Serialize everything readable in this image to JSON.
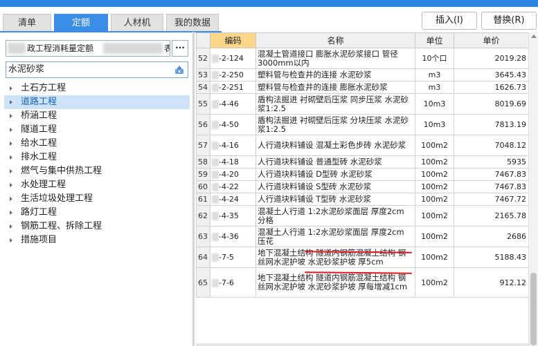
{
  "title": "",
  "tabs": [
    {
      "label": "清单",
      "active": false
    },
    {
      "label": "定额",
      "active": true
    },
    {
      "label": "人材机",
      "active": false
    },
    {
      "label": "我的数据",
      "active": false
    }
  ],
  "buttons": {
    "insert": "插入(I)",
    "replace": "替换(R)",
    "more": "···"
  },
  "library": {
    "left_text": "",
    "mid_text": "政工程消耗量定额",
    "right_text": "表"
  },
  "search": {
    "value": "水泥砂浆"
  },
  "tree": [
    {
      "label": "土石方工程",
      "selected": false
    },
    {
      "label": "道路工程",
      "selected": true
    },
    {
      "label": "桥涵工程",
      "selected": false
    },
    {
      "label": "隧道工程",
      "selected": false
    },
    {
      "label": "给水工程",
      "selected": false
    },
    {
      "label": "排水工程",
      "selected": false
    },
    {
      "label": "燃气与集中供热工程",
      "selected": false
    },
    {
      "label": "水处理工程",
      "selected": false
    },
    {
      "label": "生活垃圾处理工程",
      "selected": false
    },
    {
      "label": "路灯工程",
      "selected": false
    },
    {
      "label": "钢筋工程、拆除工程",
      "selected": false
    },
    {
      "label": "措施项目",
      "selected": false
    }
  ],
  "grid": {
    "headers": {
      "num": "",
      "code": "编码",
      "name": "名称",
      "unit": "单位",
      "price": "单价"
    },
    "rows": [
      {
        "num": "52",
        "code": "-2-124",
        "name": "混凝土管道接口 膨胀水泥砂浆接口 管径3000mm以内",
        "unit": "10个口",
        "price": "2019.28"
      },
      {
        "num": "53",
        "code": "-2-250",
        "name": "塑料管与检查井的连接 水泥砂浆",
        "unit": "m3",
        "price": "3645.43"
      },
      {
        "num": "54",
        "code": "-2-251",
        "name": "塑料管与检查井的连接 膨胀水泥砂浆",
        "unit": "m3",
        "price": "1626.73"
      },
      {
        "num": "55",
        "code": "-4-46",
        "name": "盾构法掘进 衬砌壁后压浆 同步压浆 水泥砂浆1:2.5",
        "unit": "10m3",
        "price": "8019.69"
      },
      {
        "num": "56",
        "code": "-4-50",
        "name": "盾构法掘进 衬砌壁后压浆 分块压浆 水泥砂浆1:2.5",
        "unit": "10m3",
        "price": "7813.19"
      },
      {
        "num": "57",
        "code": "-4-16",
        "name": "人行道块料铺设 混凝土彩色步砖 水泥砂浆",
        "unit": "100m2",
        "price": "7048.12"
      },
      {
        "num": "58",
        "code": "-4-18",
        "name": "人行道块料铺设 普通型砖 水泥砂浆",
        "unit": "100m2",
        "price": "5935"
      },
      {
        "num": "59",
        "code": "-4-20",
        "name": "人行道块料铺设 D型砖 水泥砂浆",
        "unit": "100m2",
        "price": "7467.83"
      },
      {
        "num": "60",
        "code": "-4-22",
        "name": "人行道块料铺设 S型砖 水泥砂浆",
        "unit": "100m2",
        "price": "7467.83"
      },
      {
        "num": "61",
        "code": "-4-24",
        "name": "人行道块料铺设 T型砖 水泥砂浆",
        "unit": "100m2",
        "price": "7467.72"
      },
      {
        "num": "62",
        "code": "-4-35",
        "name": "混凝土人行道 1:2水泥砂浆面层 厚度2cm 分格",
        "unit": "100m2",
        "price": "2165.78"
      },
      {
        "num": "63",
        "code": "-4-36",
        "name": "混凝土人行道 1:2水泥砂浆面层 厚度2cm 压花",
        "unit": "100m2",
        "price": "2686"
      },
      {
        "num": "64",
        "code": "-7-5",
        "name": "地下混凝土结构 隧道内钢筋混凝土结构 钢丝网水泥护坡 水泥砂浆护坡 厚5cm",
        "unit": "100m2",
        "price": "5188.43"
      },
      {
        "num": "65",
        "code": "-7-6",
        "name": "地下混凝土结构 隧道内钢筋混凝土结构 钢丝网水泥护坡 水泥砂浆护坡 厚每增减1cm",
        "unit": "100m2",
        "price": "912.12"
      }
    ]
  },
  "colors": {
    "accent": "#3a8ee6",
    "code_header": "#fbd68b",
    "annotation": "#e0161d"
  }
}
